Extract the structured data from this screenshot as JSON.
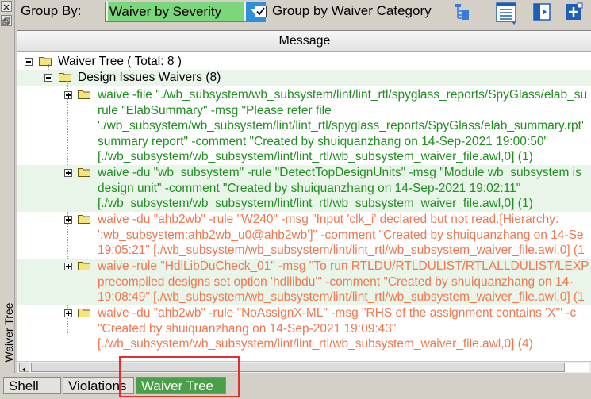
{
  "sidebar": {
    "label": "Waiver Tree"
  },
  "toolbar": {
    "group_by_label": "Group By:",
    "group_by_value": "Waiver by Severity",
    "group_by_category_label": "Group by Waiver Category",
    "group_by_category_checked": true
  },
  "table": {
    "column_header": "Message"
  },
  "tree": {
    "root": "Waiver Tree ( Total: 8 )",
    "group": "Design Issues Waivers (8)",
    "items": [
      {
        "color": "#1f8f1f",
        "lines": [
          "waive -file \"./wb_subsystem/wb_subsystem/lint/lint_rtl/spyglass_reports/SpyGlass/elab_su",
          "rule \"ElabSummary\" -msg \"Please refer file",
          "'./wb_subsystem/wb_subsystem/lint/lint_rtl/spyglass_reports/SpyGlass/elab_summary.rpt'",
          "summary report\" -comment \"Created by shuiquanzhang on 14-Sep-2021 19:00:50\"",
          "[./wb_subsystem/wb_subsystem/lint/lint_rtl/wb_subsystem_waiver_file.awl,0] (1)"
        ]
      },
      {
        "color": "#1f8f1f",
        "lines": [
          "waive -du \"wb_subsystem\" -rule \"DetectTopDesignUnits\" -msg \"Module wb_subsystem is",
          "design unit\" -comment \"Created by shuiquanzhang on 14-Sep-2021 19:02:11\"",
          "[./wb_subsystem/wb_subsystem/lint/lint_rtl/wb_subsystem_waiver_file.awl,0] (1)"
        ]
      },
      {
        "color": "#f07850",
        "lines": [
          "waive -du \"ahb2wb\" -rule \"W240\" -msg \"Input 'clk_i' declared but not read.[Hierarchy:",
          "':wb_subsystem:ahb2wb_u0@ahb2wb']\" -comment \"Created by shuiquanzhang on 14-Se",
          "19:05:21\" [./wb_subsystem/wb_subsystem/lint/lint_rtl/wb_subsystem_waiver_file.awl,0] (1"
        ]
      },
      {
        "color": "#f07850",
        "lines": [
          "waive -rule \"HdlLibDuCheck_01\" -msg \"To run RTLDU/RTLDULIST/RTLALLDULIST/LEXP",
          "precompiled designs set option 'hdllibdu'\" -comment \"Created by shuiquanzhang on 14-",
          "19:08:49\" [./wb_subsystem/wb_subsystem/lint/lint_rtl/wb_subsystem_waiver_file.awl,0] (1"
        ]
      },
      {
        "color": "#f07850",
        "lines": [
          "waive -du \"ahb2wb\" -rule \"NoAssignX-ML\" -msg \"RHS of the assignment contains 'X'\" -c",
          "\"Created by shuiquanzhang on 14-Sep-2021 19:09:43\"",
          "[./wb_subsystem/wb_subsystem/lint/lint_rtl/wb_subsystem_waiver_file.awl,0] (4)"
        ]
      }
    ]
  },
  "tabs": [
    "Shell",
    "Violations",
    "Waiver Tree"
  ],
  "active_tab": "Waiver Tree",
  "colors": {
    "accent_green": "#49a049",
    "combo_highlight": "#7cd67c",
    "highlight_box": "#e03030"
  }
}
